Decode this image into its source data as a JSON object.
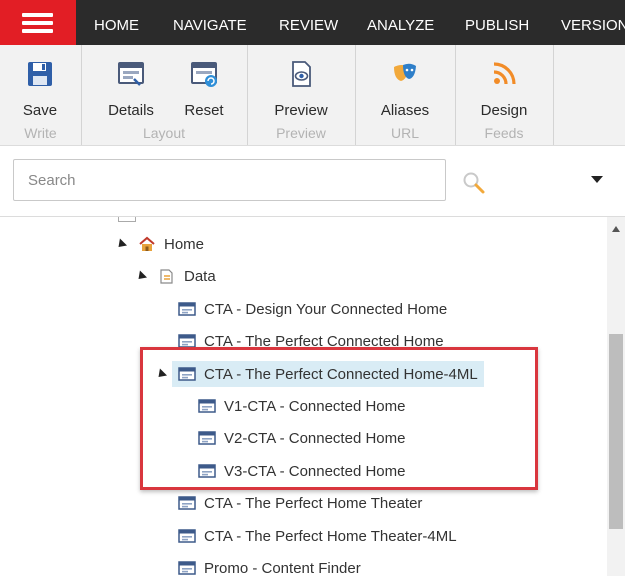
{
  "nav": {
    "tabs": [
      "HOME",
      "NAVIGATE",
      "REVIEW",
      "ANALYZE",
      "PUBLISH",
      "VERSIONS"
    ]
  },
  "ribbon": {
    "write": {
      "title": "Write",
      "save": "Save"
    },
    "layout": {
      "title": "Layout",
      "details": "Details",
      "reset": "Reset"
    },
    "preview": {
      "title": "Preview",
      "preview": "Preview"
    },
    "url": {
      "title": "URL",
      "aliases": "Aliases"
    },
    "feeds": {
      "title": "Feeds",
      "design": "Design"
    }
  },
  "search": {
    "placeholder": "Search",
    "value": ""
  },
  "tree": {
    "home": "Home",
    "data": "Data",
    "items": [
      "CTA - Design Your Connected Home",
      "CTA - The Perfect Connected Home",
      "CTA - The Perfect Connected Home-4ML",
      "V1-CTA - Connected Home",
      "V2-CTA - Connected Home",
      "V3-CTA - Connected Home",
      "CTA - The Perfect Home Theater",
      "CTA - The Perfect Home Theater-4ML",
      "Promo - Content Finder"
    ]
  },
  "colors": {
    "accent_red": "#e21e25",
    "topbar": "#2b2b2b",
    "selection": "#d9ecf5",
    "highlight_border": "#d9363e",
    "feeds_orange": "#f28c28"
  }
}
